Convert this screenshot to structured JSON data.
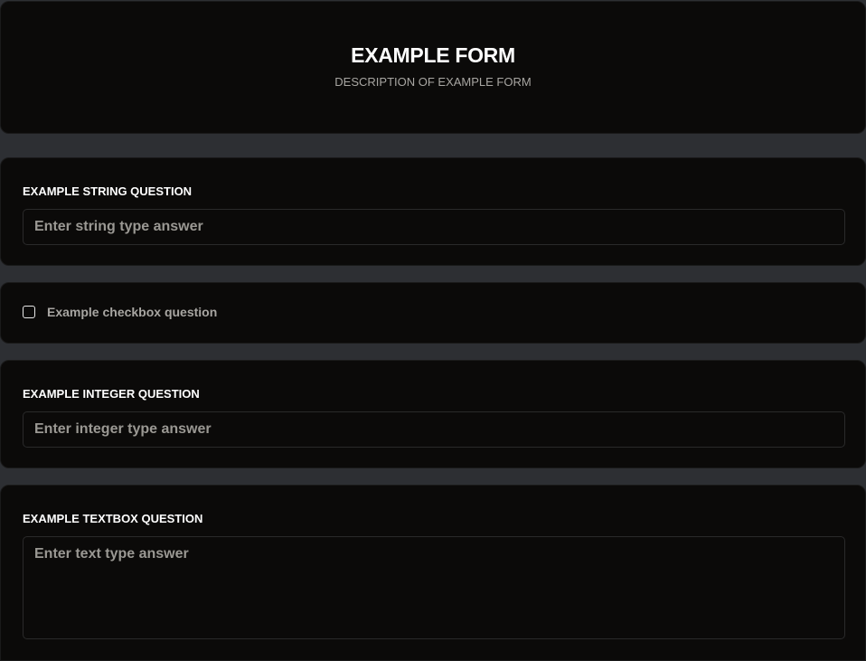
{
  "form": {
    "title": "EXAMPLE FORM",
    "description": "DESCRIPTION OF EXAMPLE FORM"
  },
  "questions": {
    "string": {
      "label": "EXAMPLE STRING QUESTION",
      "placeholder": "Enter string type answer",
      "value": ""
    },
    "checkbox": {
      "label": "Example checkbox question",
      "checked": false
    },
    "integer": {
      "label": "EXAMPLE INTEGER QUESTION",
      "placeholder": "Enter integer type answer",
      "value": ""
    },
    "textbox": {
      "label": "EXAMPLE TEXTBOX QUESTION",
      "placeholder": "Enter text type answer",
      "value": ""
    }
  },
  "colors": {
    "background": "#2d2f33",
    "card": "#0b0a09",
    "text_primary": "#ffffff",
    "text_muted": "#a8a6a2"
  }
}
